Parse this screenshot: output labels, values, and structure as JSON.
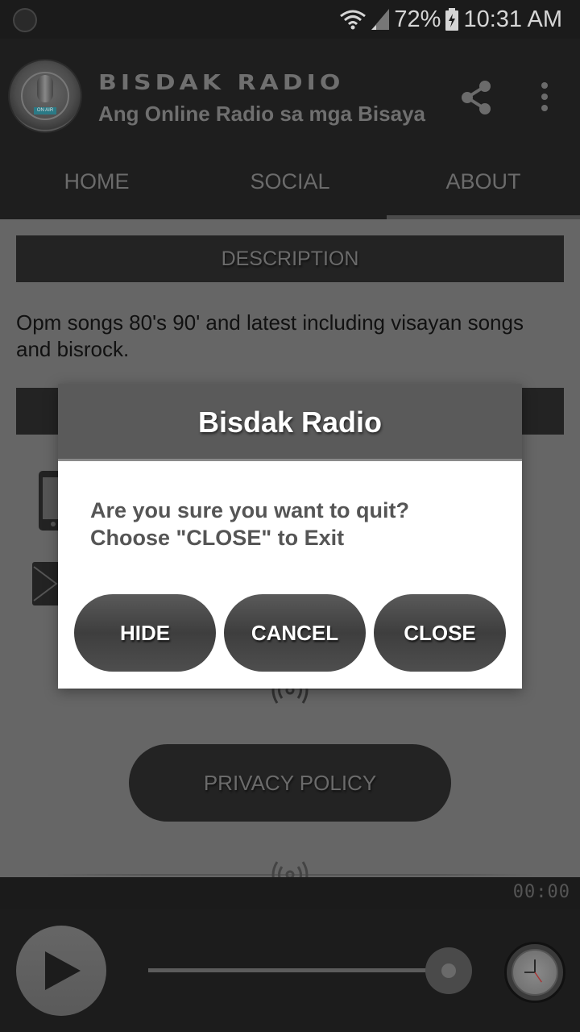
{
  "status_bar": {
    "battery_percent": "72%",
    "time": "10:31 AM",
    "icons": [
      "app-notification-icon",
      "wifi-icon",
      "signal-icon",
      "battery-charging-icon"
    ]
  },
  "app_bar": {
    "logo_alt": "Bisdak Radio logo",
    "logo_badge": "ON AIR",
    "title": "BISDAK RADIO",
    "subtitle": "Ang Online Radio sa mga Bisaya",
    "actions": [
      "share-icon",
      "more-vert-icon"
    ]
  },
  "tabs": [
    {
      "label": "HOME",
      "active": false
    },
    {
      "label": "SOCIAL",
      "active": false
    },
    {
      "label": "ABOUT",
      "active": true
    }
  ],
  "about": {
    "description_header": "DESCRIPTION",
    "description_text": "Opm songs 80's 90' and latest including visayan songs and bisrock.",
    "contact_icons": [
      "phone-icon",
      "email-icon"
    ],
    "privacy_button": "PRIVACY POLICY"
  },
  "player": {
    "timer": "00:00",
    "volume_fraction": 1.0,
    "icons": [
      "play-icon",
      "clock-icon"
    ]
  },
  "dialog": {
    "title": "Bisdak Radio",
    "message_line1": "Are you sure you want to quit?",
    "message_line2": "Choose \"CLOSE\" to Exit",
    "buttons": {
      "hide": "HIDE",
      "cancel": "CANCEL",
      "close": "CLOSE"
    }
  }
}
